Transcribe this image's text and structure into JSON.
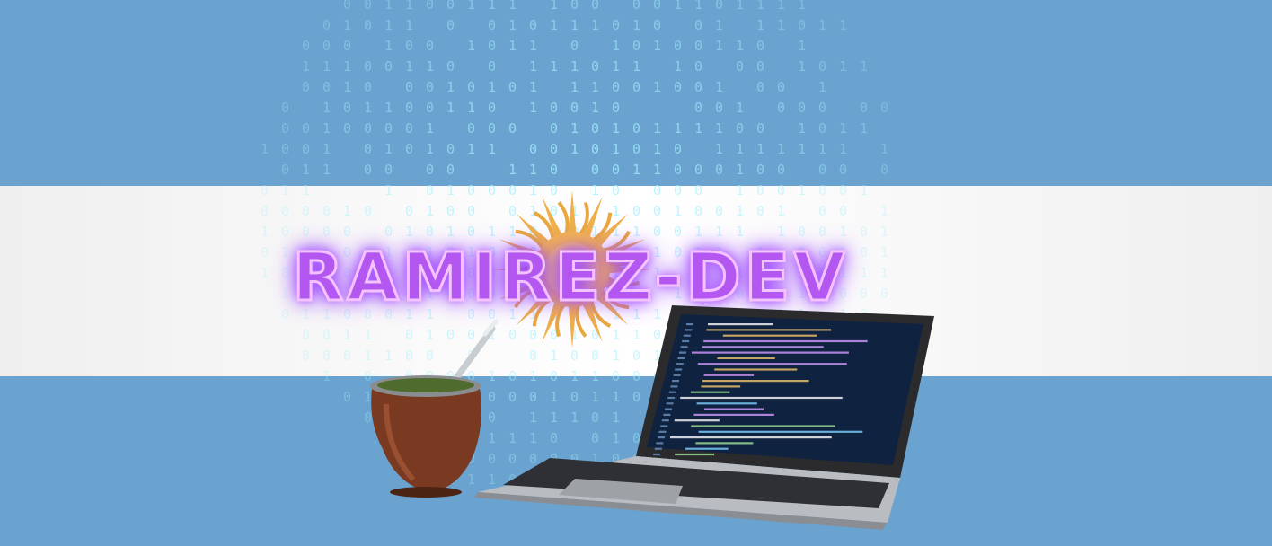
{
  "banner": {
    "title": "RAMIREZ-DEV"
  },
  "colors": {
    "flag_blue": "#6aa3cf",
    "flag_white": "#ffffff",
    "sun_gold": "#f0b14a",
    "title_glow": "#b357f0",
    "binary_cyan": "#9ff2ff"
  },
  "illustration": {
    "objects": [
      "argentina-flag",
      "sun-of-may-icon",
      "binary-code-sphere",
      "mate-gourd-icon",
      "laptop-icon"
    ]
  }
}
